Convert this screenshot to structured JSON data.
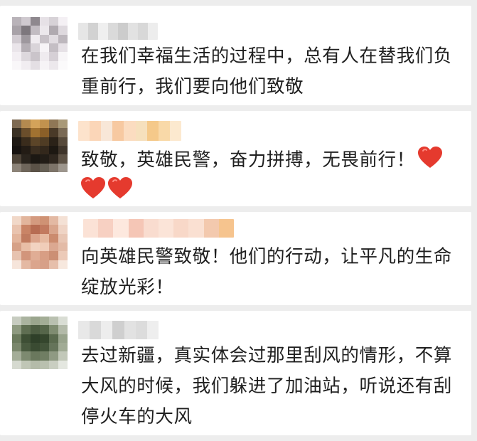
{
  "comments": [
    {
      "text": "在我们幸福生活的过程中，总有人在替我们负重前行，我们要向他们致敬",
      "avatar": [
        "#b9b3b9",
        "#cfc9cf",
        "#8e888e",
        "#e6e1e6",
        "#d7d2d7",
        "#f4f0f4",
        "#a8a2a8",
        "#7d777d",
        "#c2bcc2",
        "#ece8ec",
        "#b0aab0",
        "#ded9de",
        "#d3cdd3",
        "#9e989e",
        "#f0ecf0",
        "#c8c2c8",
        "#e1dce1",
        "#bdb7bd",
        "#eae5ea",
        "#b5afb5",
        "#d9d4d9",
        "#f7f4f7",
        "#c4bec4",
        "#e6e1e6",
        "#f3eff3",
        "#ddd8dd",
        "#cac4ca",
        "#efebef",
        "#d6d0d6",
        "#f8f6f8",
        "#f9f7f9",
        "#f1edf1",
        "#e4dfe4",
        "#f6f3f6",
        "#ece8ec",
        "#fbfafb"
      ],
      "name_colors": [
        "#e6e6e6",
        "#d2d2d2",
        "#efefef",
        "#dadada",
        "#cccccc",
        "#e2e2e2",
        "#d8d8d8",
        "#ededed"
      ]
    },
    {
      "text": "致敬，英雄民警，奋力拼搏，无畏前行！",
      "hearts_inline": 1,
      "hearts_next_line": 2,
      "avatar": [
        "#7e6a52",
        "#b48a50",
        "#d4a35a",
        "#c2924e",
        "#8f7756",
        "#a99978",
        "#3b3124",
        "#6b4e2b",
        "#a17231",
        "#8b5f28",
        "#4a3a28",
        "#7a6a55",
        "#1f1a14",
        "#3a2c1c",
        "#5c4528",
        "#4f3c24",
        "#2b2218",
        "#574a3b",
        "#171310",
        "#231c15",
        "#3b2e20",
        "#33281c",
        "#1d1812",
        "#3f352b",
        "#4e4438",
        "#2a241d",
        "#1c1813",
        "#221d17",
        "#2f271f",
        "#5d5245",
        "#8c8378",
        "#6f665b",
        "#5b5247",
        "#666055",
        "#7d7469",
        "#9d968d"
      ],
      "name_colors": [
        "#fde3cc",
        "#fbd6b8",
        "#f8e7d8",
        "#f7c9a1",
        "#fbdcc0",
        "#f6e0bd",
        "#f5c98a",
        "#f9d9a8",
        "#fce9cf"
      ]
    },
    {
      "text": "向英雄民警致敬！他们的行动，让平凡的生命绽放光彩！",
      "avatar": [
        "#f1d8c8",
        "#e2b59c",
        "#d49a7f",
        "#cf9274",
        "#e3b9a3",
        "#f4e1d5",
        "#e9c3ae",
        "#c98466",
        "#b76c52",
        "#c27a5f",
        "#d9a58c",
        "#efd4c5",
        "#e3b59c",
        "#c07b5f",
        "#dba38a",
        "#e6b9a0",
        "#cb8b6e",
        "#e8c6b4",
        "#d6a187",
        "#e8bea6",
        "#f2d3c1",
        "#f0cdb9",
        "#dba891",
        "#e3bba7",
        "#e7c3b0",
        "#d2957b",
        "#e0ad95",
        "#d89e84",
        "#cc8f74",
        "#eccab8",
        "#f6e5db",
        "#e4b9a3",
        "#dba58d",
        "#d7a088",
        "#e6bfab",
        "#f7e8de"
      ],
      "name_colors": [
        "#fbe2d6",
        "#f7d0c2",
        "#fde8de",
        "#f5c6b6",
        "#f9dccf",
        "#fbe4d8",
        "#f8d8c8",
        "#fae0d2",
        "#f3c9ae",
        "#f6c48e"
      ]
    },
    {
      "text": "去过新疆，真实体会过那里刮风的情形，不算大风的时候，我们躲进了加油站，听说还有刮停火车的大风",
      "avatar": [
        "#c7ccc0",
        "#aab39f",
        "#9aa58d",
        "#a3ad96",
        "#b9c0b0",
        "#d9ddd4",
        "#8e9a80",
        "#5f6e52",
        "#4d5d42",
        "#56664a",
        "#7f8c71",
        "#b3baa9",
        "#6b7a5d",
        "#3e4f35",
        "#2f4029",
        "#35462d",
        "#5a6a4e",
        "#98a38c",
        "#7a876c",
        "#495a3f",
        "#3a4b32",
        "#425339",
        "#65745a",
        "#a1ab95",
        "#a4ad98",
        "#7d8a70",
        "#6a785d",
        "#707e63",
        "#8f9a83",
        "#c2c8b9",
        "#d6dad0",
        "#c0c6b6",
        "#b4bba9",
        "#b9c0af",
        "#c9cec1",
        "#e4e7e0"
      ],
      "name_colors": [
        "#e8e8e8",
        "#d9d9d9",
        "#ededed",
        "#cfcfcf",
        "#e2e2e2",
        "#dcdcdc",
        "#eeeeee"
      ]
    }
  ]
}
